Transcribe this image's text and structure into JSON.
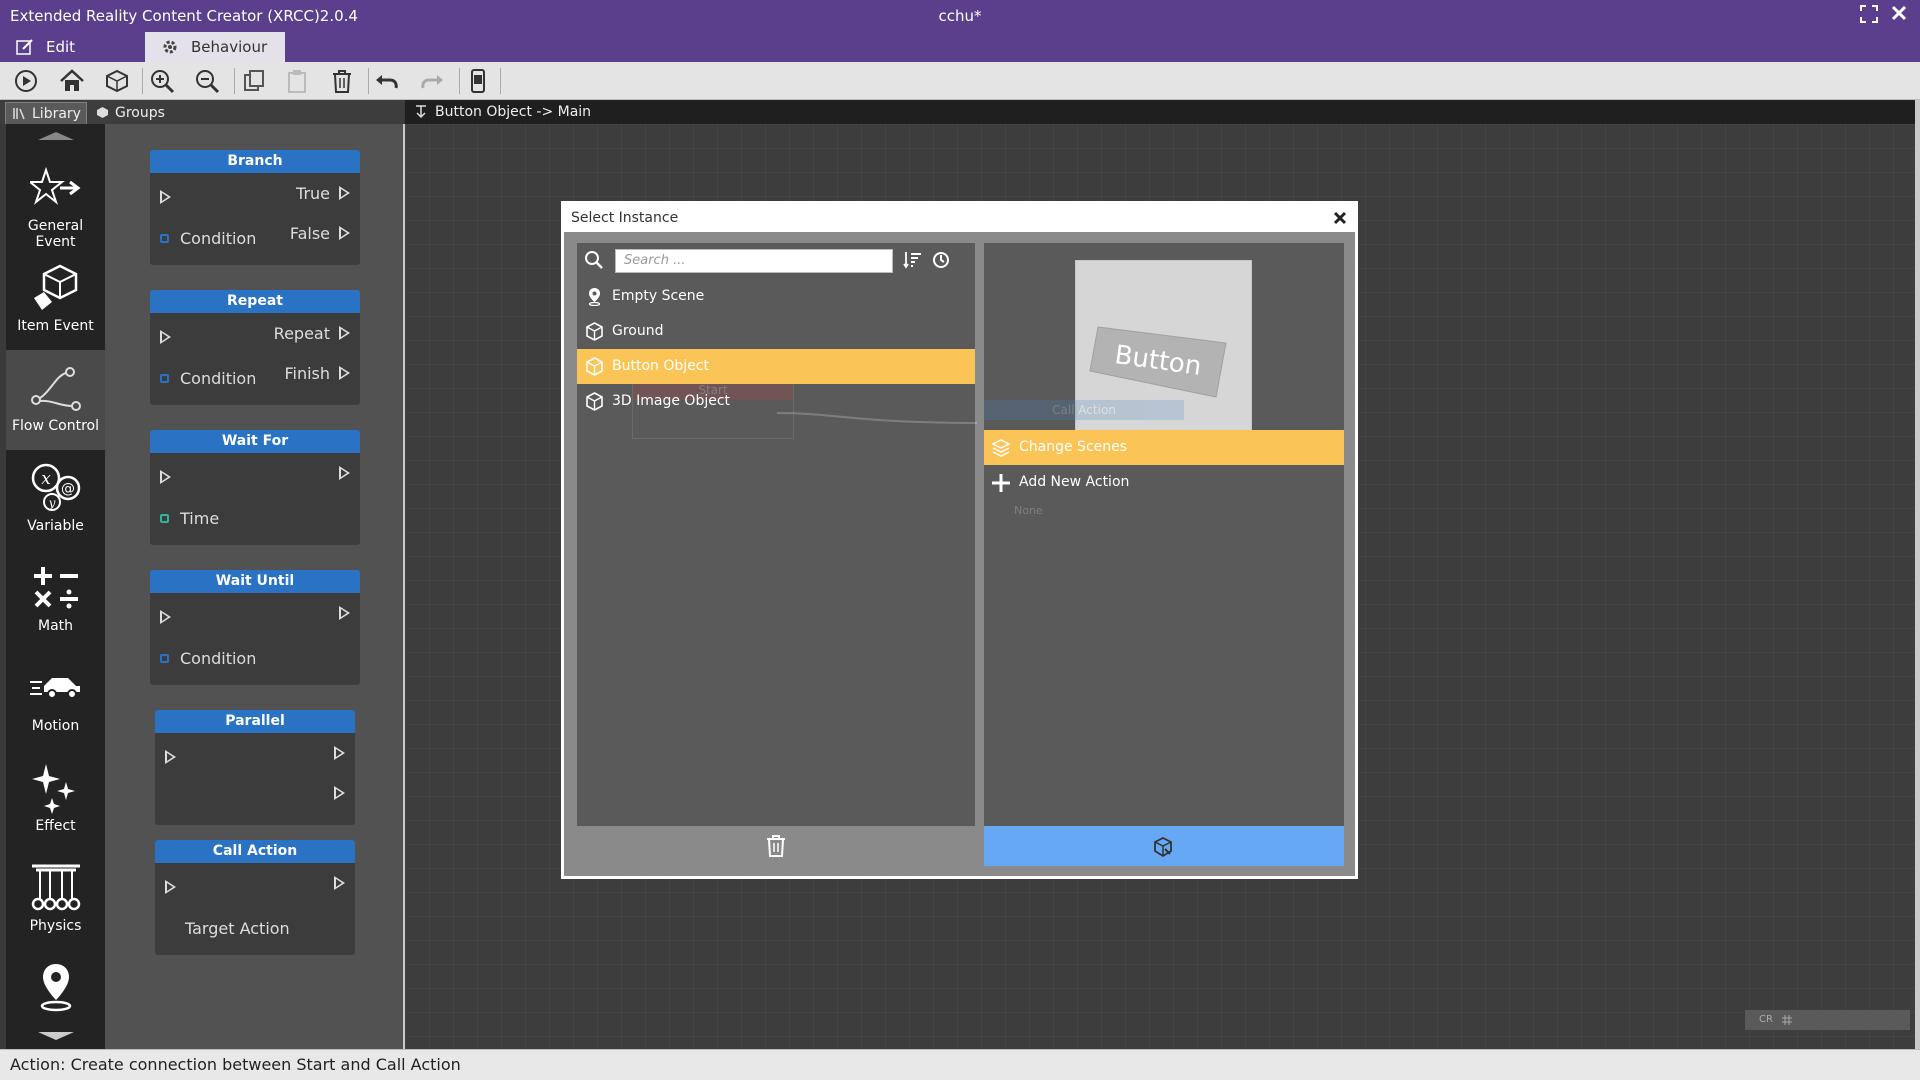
{
  "app": {
    "title": "Extended Reality Content Creator (XRCC)2.0.4",
    "document_title": "cchu*"
  },
  "mode_tabs": [
    {
      "label": "Edit",
      "active": false
    },
    {
      "label": "Behaviour",
      "active": true
    }
  ],
  "toolbar": {
    "buttons": [
      "play-icon",
      "home-icon",
      "scene-cube-icon",
      "zoom-in-icon",
      "zoom-out-icon",
      "copy-icon",
      "paste-icon",
      "trash-icon",
      "undo-icon",
      "redo-icon",
      "device-preview-icon"
    ]
  },
  "left_tabs": [
    {
      "label": "Library",
      "active": true
    },
    {
      "label": "Groups",
      "active": false
    }
  ],
  "categories": [
    {
      "label": "General Event",
      "icon": "star-arrow-icon"
    },
    {
      "label": "Item Event",
      "icon": "cube-hand-icon"
    },
    {
      "label": "Flow Control",
      "icon": "branch-flow-icon",
      "active": true
    },
    {
      "label": "Variable",
      "icon": "variable-icon"
    },
    {
      "label": "Math",
      "icon": "math-operators-icon"
    },
    {
      "label": "Motion",
      "icon": "car-motion-icon"
    },
    {
      "label": "Effect",
      "icon": "sparkle-icon"
    },
    {
      "label": "Physics",
      "icon": "newtons-cradle-icon"
    }
  ],
  "nodes": {
    "branch": {
      "title": "Branch",
      "out_true": "True",
      "out_false": "False",
      "in_condition": "Condition"
    },
    "repeat": {
      "title": "Repeat",
      "out_repeat": "Repeat",
      "out_finish": "Finish",
      "in_condition": "Condition"
    },
    "wait_for": {
      "title": "Wait For",
      "in_time": "Time"
    },
    "wait_until": {
      "title": "Wait Until",
      "in_condition": "Condition"
    },
    "parallel": {
      "title": "Parallel"
    },
    "call_action": {
      "title": "Call Action",
      "target": "Target Action"
    }
  },
  "canvas": {
    "breadcrumb": "Button Object -> Main",
    "mini_label": "CR"
  },
  "dialog": {
    "title": "Select Instance",
    "search_placeholder": "Search ...",
    "instances": [
      {
        "label": "Empty Scene",
        "icon": "pin-icon",
        "selected": false
      },
      {
        "label": "Ground",
        "icon": "cube-icon",
        "selected": false
      },
      {
        "label": "Button Object",
        "icon": "cube-icon",
        "selected": true
      },
      {
        "label": "3D Image Object",
        "icon": "cube-icon",
        "selected": false
      }
    ],
    "preview_text": "Button",
    "actions": [
      {
        "label": "Change Scenes",
        "icon": "layers-icon",
        "selected": true
      },
      {
        "label": "Add New Action",
        "icon": "plus-icon",
        "selected": false
      }
    ],
    "ghost_start": "Start",
    "ghost_call_action": "Call Action",
    "ghost_none": "None"
  },
  "status": {
    "text": "Action: Create connection between Start and Call Action"
  },
  "colors": {
    "titlebar": "#5b3e8c",
    "node_header": "#2a72c4",
    "selection": "#fbc457",
    "confirm_button": "#66a8f4"
  }
}
